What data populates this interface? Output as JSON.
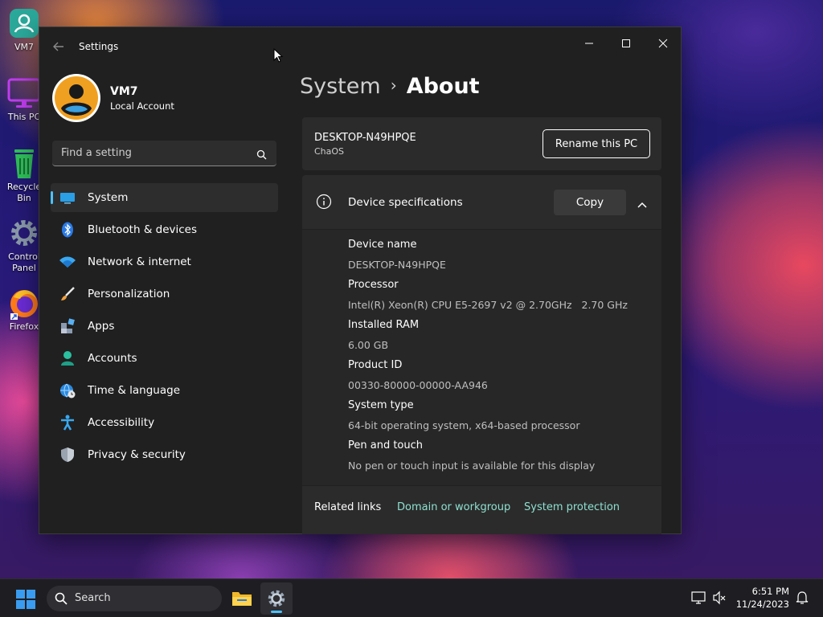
{
  "desktop": {
    "icons": [
      {
        "label": "VM7"
      },
      {
        "label": "This PC"
      },
      {
        "label": "Recycle Bin"
      },
      {
        "label": "Control Panel"
      },
      {
        "label": "Firefox"
      }
    ]
  },
  "window": {
    "app_title": "Settings"
  },
  "profile": {
    "name": "VM7",
    "account_type": "Local Account"
  },
  "search": {
    "placeholder": "Find a setting"
  },
  "nav": {
    "items": [
      {
        "label": "System",
        "icon": "monitor-icon",
        "active": true
      },
      {
        "label": "Bluetooth & devices",
        "icon": "bluetooth-icon"
      },
      {
        "label": "Network & internet",
        "icon": "wifi-icon"
      },
      {
        "label": "Personalization",
        "icon": "brush-icon"
      },
      {
        "label": "Apps",
        "icon": "apps-icon"
      },
      {
        "label": "Accounts",
        "icon": "person-icon"
      },
      {
        "label": "Time & language",
        "icon": "globe-clock-icon"
      },
      {
        "label": "Accessibility",
        "icon": "accessibility-icon"
      },
      {
        "label": "Privacy & security",
        "icon": "shield-icon"
      }
    ]
  },
  "breadcrumb": {
    "parent": "System",
    "separator": "›",
    "current": "About"
  },
  "pc": {
    "name": "DESKTOP-N49HPQE",
    "org": "ChaOS",
    "rename_label": "Rename this PC"
  },
  "specs": {
    "title": "Device specifications",
    "copy_label": "Copy",
    "rows": [
      {
        "key": "Device name",
        "value": "DESKTOP-N49HPQE"
      },
      {
        "key": "Processor",
        "value": "Intel(R) Xeon(R) CPU E5-2697 v2 @ 2.70GHz   2.70 GHz"
      },
      {
        "key": "Installed RAM",
        "value": "6.00 GB"
      },
      {
        "key": "Product ID",
        "value": "00330-80000-00000-AA946"
      },
      {
        "key": "System type",
        "value": "64-bit operating system, x64-based processor"
      },
      {
        "key": "Pen and touch",
        "value": "No pen or touch input is available for this display"
      }
    ]
  },
  "related": {
    "title": "Related links",
    "links": [
      "Domain or workgroup",
      "System protection"
    ]
  },
  "taskbar": {
    "search_label": "Search",
    "time": "6:51 PM",
    "date": "11/24/2023"
  },
  "colors": {
    "accent": "#4cc2ff",
    "link": "#8ee0d0",
    "window_bg": "#202020",
    "card_bg": "#2b2b2b"
  }
}
